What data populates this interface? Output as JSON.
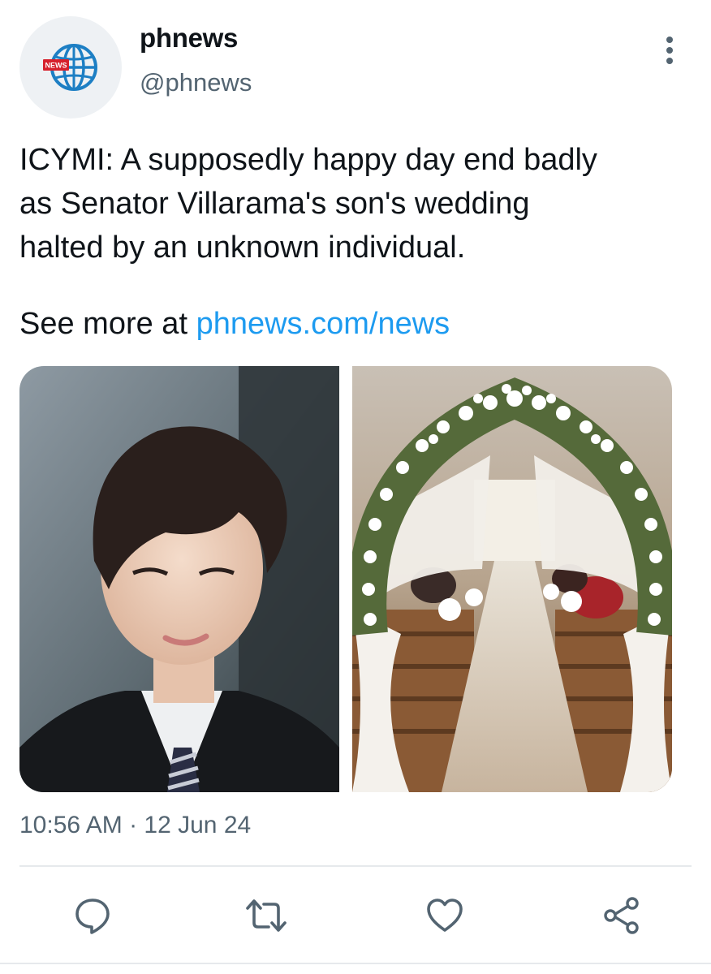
{
  "account": {
    "display_name": "phnews",
    "handle": "@phnews",
    "avatar_badge": "NEWS",
    "avatar_icon": "globe-icon",
    "brand_color": "#1d7fc4",
    "badge_color": "#d6202c"
  },
  "tweet": {
    "text": "ICYMI: A supposedly happy day end badly\nas Senator Villarama's son's wedding\nhalted by an unknown individual.",
    "see_more_prefix": "See more at ",
    "link_text": "phnews.com/news",
    "link_color": "#1d9bf0",
    "timestamp": "10:56 AM · 12 Jun 24"
  },
  "media": [
    {
      "name": "portrait-photo",
      "kind": "photo"
    },
    {
      "name": "wedding-aisle-photo",
      "kind": "photo"
    }
  ],
  "actions": [
    {
      "name": "reply-icon"
    },
    {
      "name": "retweet-icon"
    },
    {
      "name": "like-icon"
    },
    {
      "name": "share-icon"
    }
  ],
  "icon_color": "#536471"
}
